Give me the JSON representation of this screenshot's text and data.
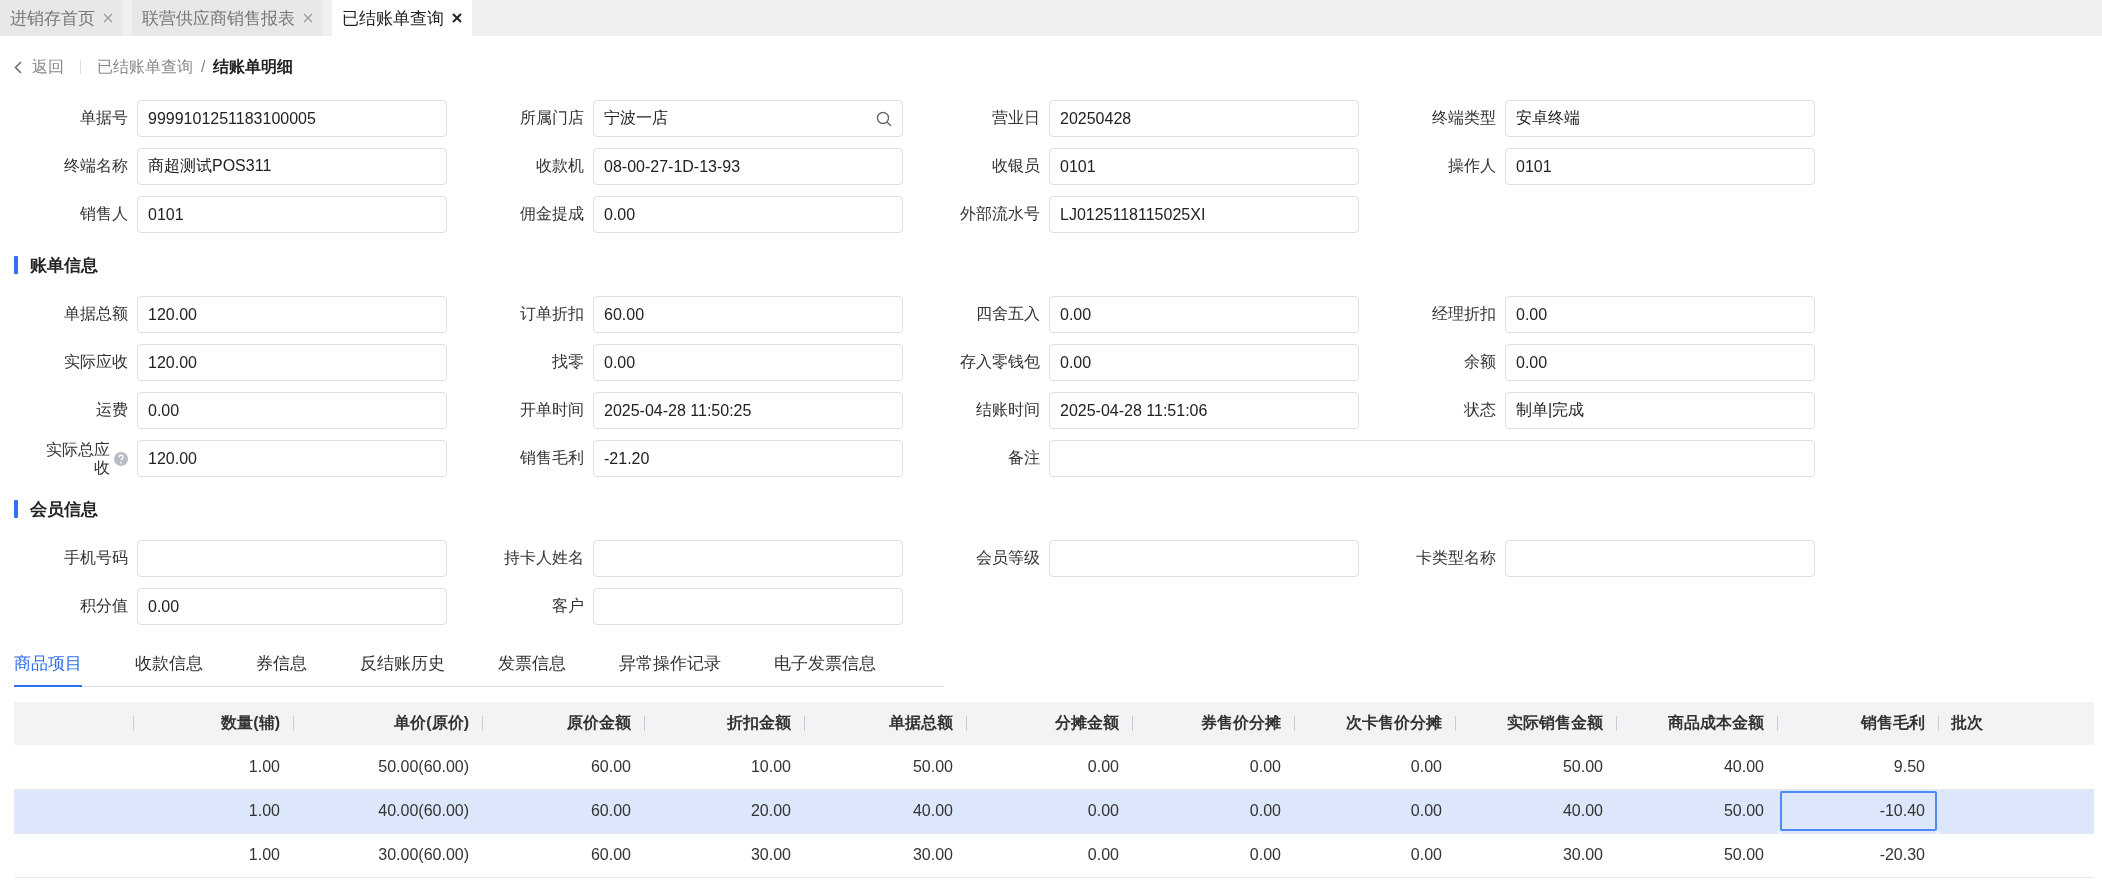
{
  "tabs": [
    {
      "label": "进销存首页",
      "selected": false
    },
    {
      "label": "联营供应商销售报表",
      "selected": false
    },
    {
      "label": "已结账单查询",
      "selected": true
    }
  ],
  "breadcrumb": {
    "back": "返回",
    "parent": "已结账单查询",
    "separator": "/",
    "current": "结账单明细"
  },
  "basic_fields": [
    {
      "label": "单据号",
      "value": "9999101251183100005",
      "kind": "text"
    },
    {
      "label": "所属门店",
      "value": "宁波一店",
      "kind": "search"
    },
    {
      "label": "营业日",
      "value": "20250428",
      "kind": "text"
    },
    {
      "label": "终端类型",
      "value": "安卓终端",
      "kind": "text"
    },
    {
      "label": "终端名称",
      "value": "商超测试POS311",
      "kind": "text"
    },
    {
      "label": "收款机",
      "value": "08-00-27-1D-13-93",
      "kind": "text"
    },
    {
      "label": "收银员",
      "value": "0101",
      "kind": "text"
    },
    {
      "label": "操作人",
      "value": "0101",
      "kind": "text"
    },
    {
      "label": "销售人",
      "value": "0101",
      "kind": "text"
    },
    {
      "label": "佣金提成",
      "value": "0.00",
      "kind": "text"
    },
    {
      "label": "外部流水号",
      "value": "LJ0125118115025XI",
      "kind": "text"
    }
  ],
  "sections": [
    {
      "title": "账单信息",
      "fields": [
        {
          "label": "单据总额",
          "value": "120.00",
          "kind": "text"
        },
        {
          "label": "订单折扣",
          "value": "60.00",
          "kind": "text"
        },
        {
          "label": "四舍五入",
          "value": "0.00",
          "kind": "text"
        },
        {
          "label": "经理折扣",
          "value": "0.00",
          "kind": "text"
        },
        {
          "label": "实际应收",
          "value": "120.00",
          "kind": "text"
        },
        {
          "label": "找零",
          "value": "0.00",
          "kind": "text"
        },
        {
          "label": "存入零钱包",
          "value": "0.00",
          "kind": "text"
        },
        {
          "label": "余额",
          "value": "0.00",
          "kind": "text"
        },
        {
          "label": "运费",
          "value": "0.00",
          "kind": "text"
        },
        {
          "label": "开单时间",
          "value": "2025-04-28 11:50:25",
          "kind": "text"
        },
        {
          "label": "结账时间",
          "value": "2025-04-28 11:51:06",
          "kind": "text"
        },
        {
          "label": "状态",
          "value": "制单|完成",
          "kind": "text"
        },
        {
          "label": "实际总应收",
          "value": "120.00",
          "kind": "help"
        },
        {
          "label": "销售毛利",
          "value": "-21.20",
          "kind": "text"
        },
        {
          "label": "备注",
          "kind": "wide"
        }
      ]
    },
    {
      "title": "会员信息",
      "fields": [
        {
          "label": "手机号码",
          "kind": "text"
        },
        {
          "label": "持卡人姓名",
          "kind": "text"
        },
        {
          "label": "会员等级",
          "kind": "text"
        },
        {
          "label": "卡类型名称",
          "kind": "text"
        },
        {
          "label": "积分值",
          "value": "0.00",
          "kind": "text"
        },
        {
          "label": "客户",
          "kind": "text"
        }
      ]
    }
  ],
  "detail_tabs": [
    {
      "label": "商品项目",
      "selected": true
    },
    {
      "label": "收款信息",
      "selected": false
    },
    {
      "label": "券信息",
      "selected": false
    },
    {
      "label": "反结账历史",
      "selected": false
    },
    {
      "label": "发票信息",
      "selected": false
    },
    {
      "label": "异常操作记录",
      "selected": false
    },
    {
      "label": "电子发票信息",
      "selected": false
    }
  ],
  "table": {
    "columns": [
      "数量(辅)",
      "单价(原价)",
      "原价金额",
      "折扣金额",
      "单据总额",
      "分摊金额",
      "券售价分摊",
      "次卡售价分摊",
      "实际销售金额",
      "商品成本金额",
      "销售毛利",
      "批次"
    ],
    "rows": [
      {
        "selected": false,
        "cells": [
          {
            "text": "1.00",
            "focused": false
          },
          {
            "text": "50.00(60.00)",
            "focused": false
          },
          {
            "text": "60.00",
            "focused": false
          },
          {
            "text": "10.00",
            "focused": false
          },
          {
            "text": "50.00",
            "focused": false
          },
          {
            "text": "0.00",
            "focused": false
          },
          {
            "text": "0.00",
            "focused": false
          },
          {
            "text": "0.00",
            "focused": false
          },
          {
            "text": "50.00",
            "focused": false
          },
          {
            "text": "40.00",
            "focused": false
          },
          {
            "text": "9.50",
            "focused": false
          }
        ]
      },
      {
        "selected": true,
        "cells": [
          {
            "text": "1.00",
            "focused": false
          },
          {
            "text": "40.00(60.00)",
            "focused": false
          },
          {
            "text": "60.00",
            "focused": false
          },
          {
            "text": "20.00",
            "focused": false
          },
          {
            "text": "40.00",
            "focused": false
          },
          {
            "text": "0.00",
            "focused": false
          },
          {
            "text": "0.00",
            "focused": false
          },
          {
            "text": "0.00",
            "focused": false
          },
          {
            "text": "40.00",
            "focused": false
          },
          {
            "text": "50.00",
            "focused": false
          },
          {
            "text": "-10.40",
            "focused": true
          }
        ]
      },
      {
        "selected": false,
        "cells": [
          {
            "text": "1.00",
            "focused": false
          },
          {
            "text": "30.00(60.00)",
            "focused": false
          },
          {
            "text": "60.00",
            "focused": false
          },
          {
            "text": "30.00",
            "focused": false
          },
          {
            "text": "30.00",
            "focused": false
          },
          {
            "text": "0.00",
            "focused": false
          },
          {
            "text": "0.00",
            "focused": false
          },
          {
            "text": "0.00",
            "focused": false
          },
          {
            "text": "30.00",
            "focused": false
          },
          {
            "text": "50.00",
            "focused": false
          },
          {
            "text": "-20.30",
            "focused": false
          }
        ]
      }
    ]
  }
}
